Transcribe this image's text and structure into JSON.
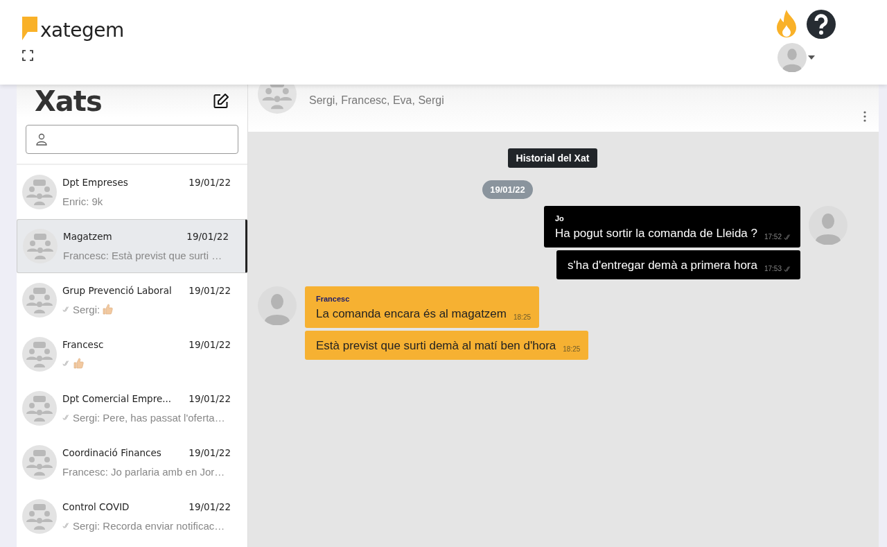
{
  "brand": {
    "name": "xategem"
  },
  "sidebar": {
    "title": "Xats"
  },
  "chats": [
    {
      "name": "Dpt Empreses",
      "date": "19/01/22",
      "preview": "Enric: 9k",
      "ticks": false,
      "thumbs_up": false,
      "selected": false
    },
    {
      "name": "Magatzem",
      "date": "19/01/22",
      "preview": "Francesc: Està previst que surti …",
      "ticks": false,
      "thumbs_up": false,
      "selected": true
    },
    {
      "name": "Grup Prevenció Laboral",
      "date": "19/01/22",
      "preview": "Sergi:",
      "ticks": true,
      "thumbs_up": true,
      "selected": false
    },
    {
      "name": "Francesc",
      "date": "19/01/22",
      "ticks": true,
      "thumbs_up": true,
      "selected": false
    },
    {
      "name": "Dpt Comercial Empre...",
      "date": "19/01/22",
      "preview": "Sergi: Pere, has passat l'oferta…",
      "ticks": true,
      "thumbs_up": false,
      "selected": false
    },
    {
      "name": "Coordinació Finances",
      "date": "19/01/22",
      "preview": "Francesc: Jo parlaria amb en Jor…",
      "ticks": false,
      "thumbs_up": false,
      "selected": false
    },
    {
      "name": "Control COVID",
      "date": "19/01/22",
      "preview": "Sergi: Recorda enviar notificac…",
      "ticks": true,
      "thumbs_up": false,
      "selected": false
    }
  ],
  "conversation": {
    "members": "Sergi, Francesc, Eva, Sergi",
    "history_label": "Historial del Xat",
    "date_badge": "19/01/22",
    "messages": [
      {
        "kind": "outgoing",
        "sender": "Jo",
        "text": "Ha pogut sortir la comanda de Lleida ?",
        "time": "17:52",
        "ticks": true
      },
      {
        "kind": "outgoing",
        "text": "s'ha d'entregar demà a primera hora",
        "time": "17:53",
        "ticks": true
      },
      {
        "kind": "incoming",
        "sender": "Francesc",
        "text": "La comanda encara és al magatzem",
        "time": "18:25",
        "ticks": false
      },
      {
        "kind": "incoming",
        "text": "Està previst que surti demà al matí ben d'hora",
        "time": "18:25",
        "ticks": false
      }
    ]
  }
}
